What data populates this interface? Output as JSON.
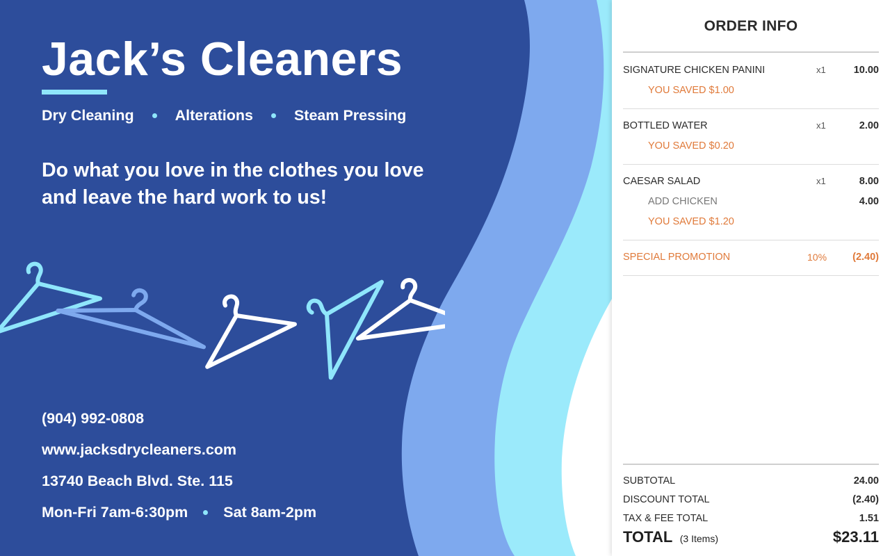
{
  "brand": {
    "name": "Jack’s Cleaners",
    "services": [
      "Dry Cleaning",
      "Alterations",
      "Steam Pressing"
    ],
    "tagline_line1": "Do what you love in the clothes you love",
    "tagline_line2": "and leave the hard work to us!"
  },
  "contact": {
    "phone": "(904) 992-0808",
    "website": "www.jacksdrycleaners.com",
    "address": "13740 Beach Blvd. Ste. 115",
    "hours_weekday": "Mon-Fri 7am-6:30pm",
    "hours_saturday": "Sat 8am-2pm"
  },
  "order": {
    "title": "ORDER INFO",
    "items": [
      {
        "name": "SIGNATURE CHICKEN PANINI",
        "qty": "x1",
        "price": "10.00",
        "saved": "YOU SAVED $1.00"
      },
      {
        "name": "BOTTLED WATER",
        "qty": "x1",
        "price": "2.00",
        "saved": "YOU SAVED $0.20"
      },
      {
        "name": "CAESAR SALAD",
        "qty": "x1",
        "price": "8.00",
        "modifier": "ADD CHICKEN",
        "modifier_price": "4.00",
        "saved": "YOU SAVED $1.20"
      }
    ],
    "promotion": {
      "label": "SPECIAL PROMOTION",
      "percent": "10%",
      "amount": "(2.40)"
    },
    "summary": {
      "subtotal_label": "SUBTOTAL",
      "subtotal": "24.00",
      "discount_label": "DISCOUNT TOTAL",
      "discount": "(2.40)",
      "tax_label": "TAX & FEE TOTAL",
      "tax": "1.51",
      "total_label": "TOTAL",
      "total_count": "(3 Items)",
      "total": "$23.11"
    }
  },
  "colors": {
    "promo_background": "#2d4d9b",
    "wave_mid": "#7ea9ee",
    "wave_light": "#9beafb",
    "accent_savings": "#e07a3a"
  },
  "icons": [
    "hanger-icon"
  ]
}
